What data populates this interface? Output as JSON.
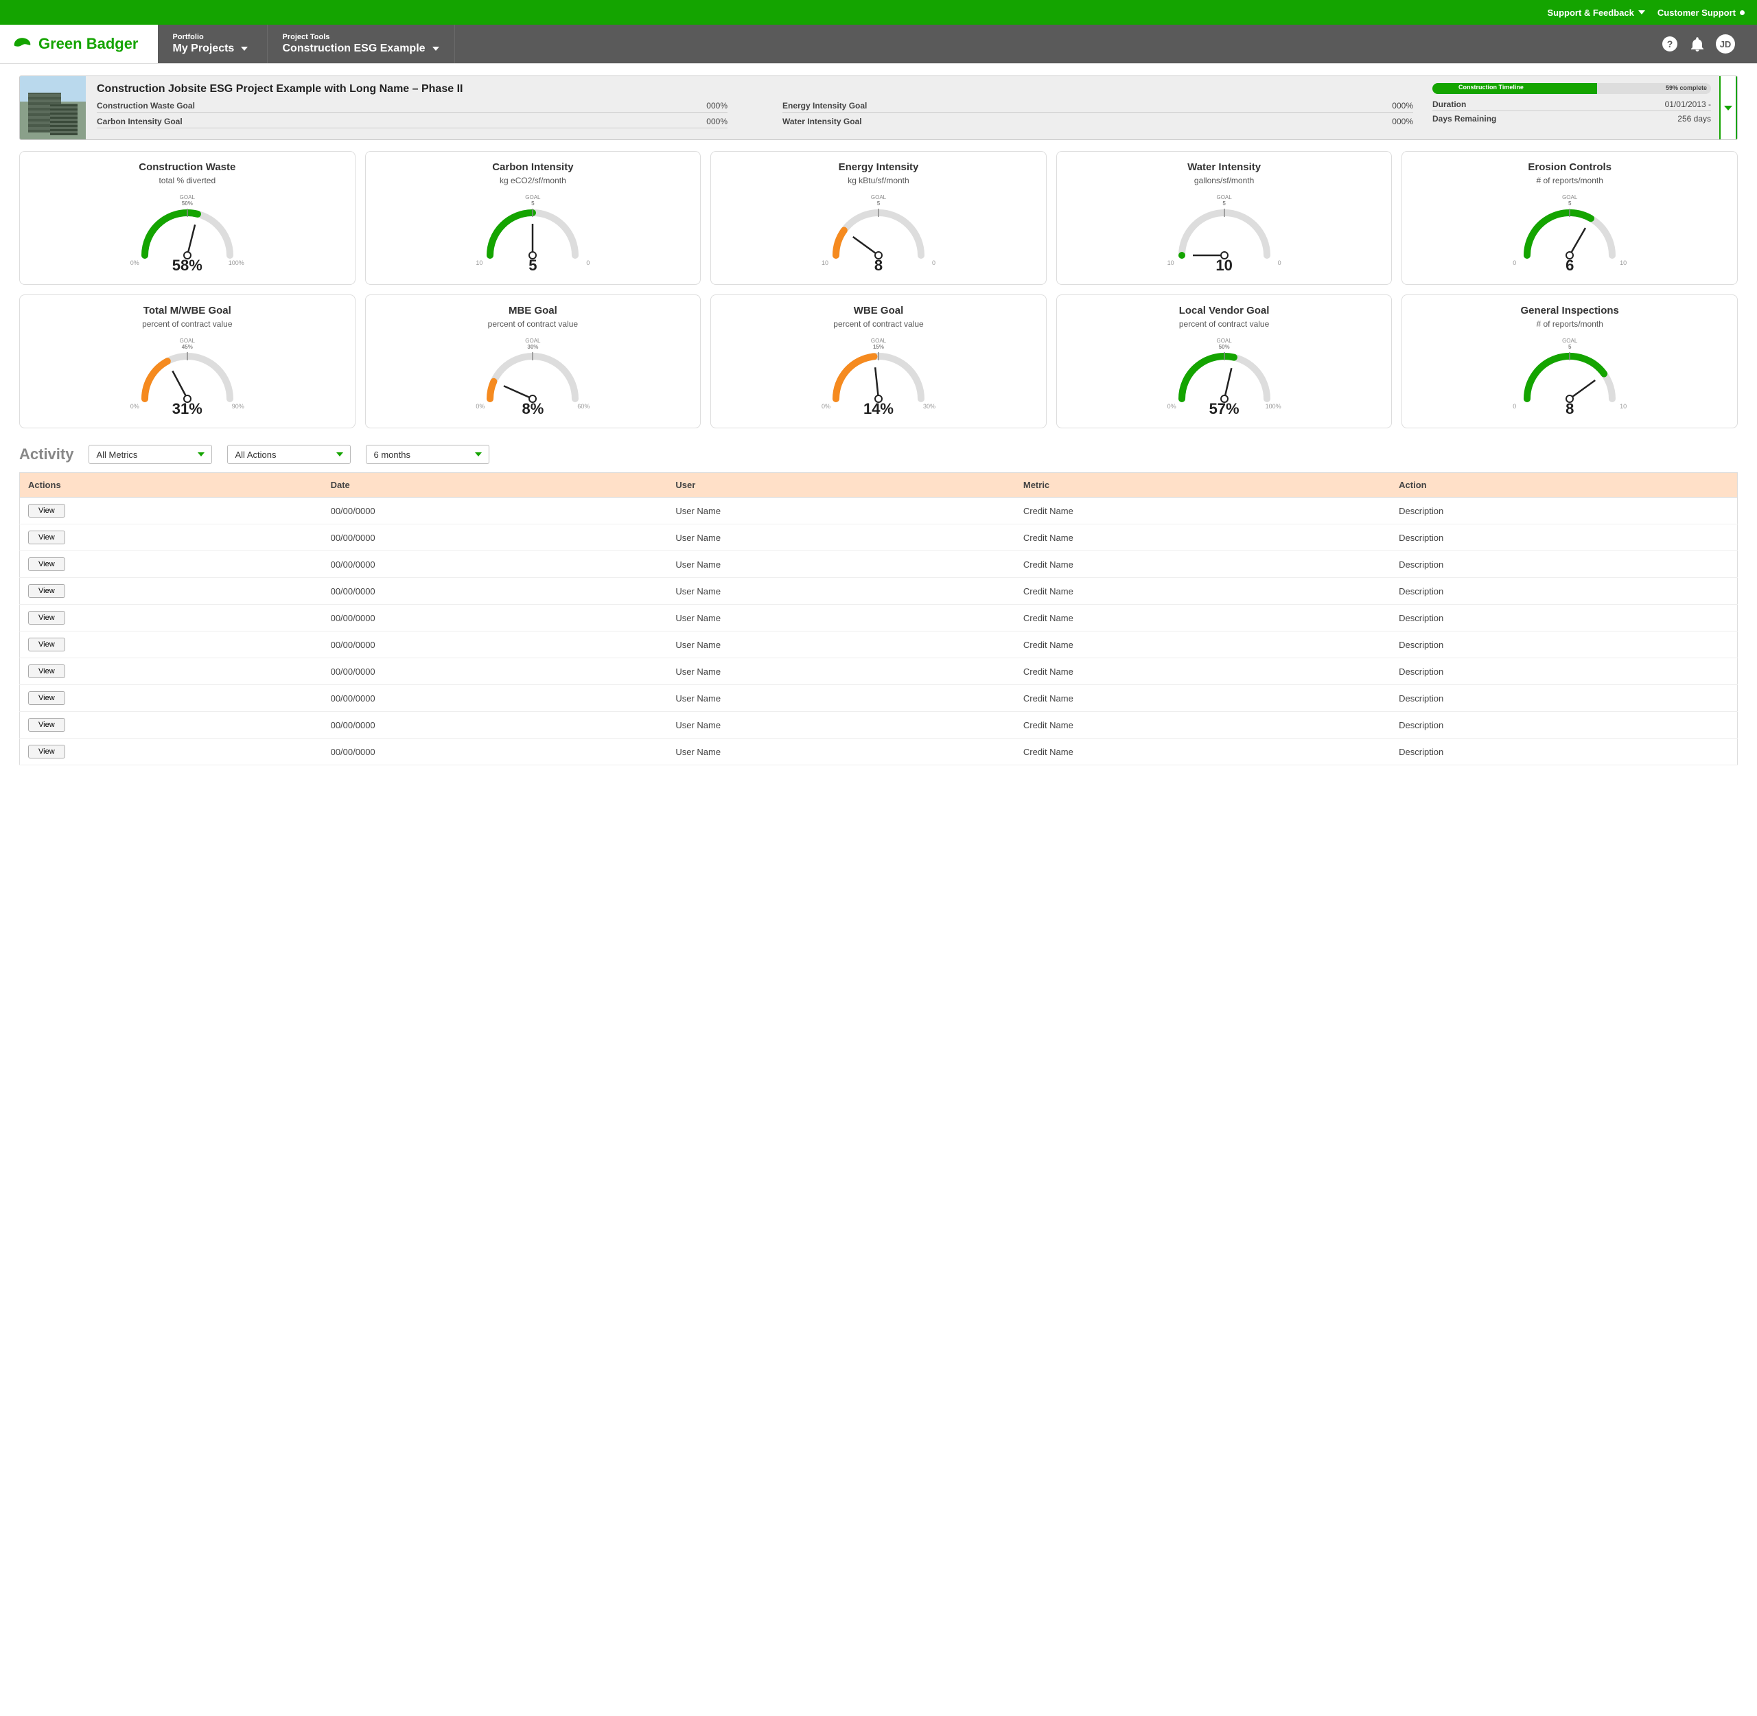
{
  "colors": {
    "brand": "#14a400",
    "accent_orange": "#f58a1f"
  },
  "topbar": {
    "support_feedback": "Support & Feedback",
    "customer_support": "Customer Support"
  },
  "brand": "Green Badger",
  "nav": {
    "portfolio_small": "Portfolio",
    "portfolio_big": "My Projects",
    "tools_small": "Project Tools",
    "tools_big": "Construction ESG Example"
  },
  "user": {
    "initials": "JD"
  },
  "project": {
    "title": "Construction Jobsite ESG Project Example with Long Name – Phase II",
    "timeline_label": "Construction Timeline",
    "timeline_pct": "59% complete",
    "goals": [
      {
        "label": "Construction Waste Goal",
        "value": "000%"
      },
      {
        "label": "Energy Intensity Goal",
        "value": "000%"
      },
      {
        "label": "Duration",
        "value": "01/01/2013 -"
      },
      {
        "label": "Carbon Intensity Goal",
        "value": "000%"
      },
      {
        "label": "Water Intensity Goal",
        "value": "000%"
      },
      {
        "label": "Days Remaining",
        "value": "256 days"
      }
    ]
  },
  "gauges": [
    {
      "title": "Construction Waste",
      "sub": "total % diverted",
      "goal": "50%",
      "left": "0%",
      "right": "100%",
      "value": "58%",
      "fill_deg": 104,
      "color": "#14a400"
    },
    {
      "title": "Carbon Intensity",
      "sub": "kg eCO2/sf/month",
      "goal": "5",
      "left": "10",
      "right": "0",
      "value": "5",
      "fill_deg": 90,
      "color": "#14a400"
    },
    {
      "title": "Energy Intensity",
      "sub": "kg kBtu/sf/month",
      "goal": "5",
      "left": "10",
      "right": "0",
      "value": "8",
      "fill_deg": 36,
      "color": "#f58a1f"
    },
    {
      "title": "Water Intensity",
      "sub": "gallons/sf/month",
      "goal": "5",
      "left": "10",
      "right": "0",
      "value": "10",
      "fill_deg": 0,
      "color": "#14a400"
    },
    {
      "title": "Erosion Controls",
      "sub": "# of reports/month",
      "goal": "5",
      "left": "0",
      "right": "10",
      "value": "6",
      "fill_deg": 120,
      "color": "#14a400"
    },
    {
      "title": "Total M/WBE Goal",
      "sub": "percent of contract value",
      "goal": "45%",
      "left": "0%",
      "right": "90%",
      "value": "31%",
      "fill_deg": 62,
      "color": "#f58a1f"
    },
    {
      "title": "MBE Goal",
      "sub": "percent of contract value",
      "goal": "30%",
      "left": "0%",
      "right": "60%",
      "value": "8%",
      "fill_deg": 24,
      "color": "#f58a1f"
    },
    {
      "title": "WBE Goal",
      "sub": "percent of contract value",
      "goal": "15%",
      "left": "0%",
      "right": "30%",
      "value": "14%",
      "fill_deg": 84,
      "color": "#f58a1f"
    },
    {
      "title": "Local Vendor Goal",
      "sub": "percent of contract value",
      "goal": "50%",
      "left": "0%",
      "right": "100%",
      "value": "57%",
      "fill_deg": 103,
      "color": "#14a400"
    },
    {
      "title": "General Inspections",
      "sub": "# of reports/month",
      "goal": "5",
      "left": "0",
      "right": "10",
      "value": "8",
      "fill_deg": 144,
      "color": "#14a400"
    }
  ],
  "activity": {
    "heading": "Activity",
    "filter_metrics": "All Metrics",
    "filter_actions": "All Actions",
    "filter_range": "6 months",
    "columns": [
      "Actions",
      "Date",
      "User",
      "Metric",
      "Action"
    ],
    "view_label": "View",
    "rows": [
      {
        "date": "00/00/0000",
        "user": "User Name",
        "metric": "Credit Name",
        "action": "Description"
      },
      {
        "date": "00/00/0000",
        "user": "User Name",
        "metric": "Credit Name",
        "action": "Description"
      },
      {
        "date": "00/00/0000",
        "user": "User Name",
        "metric": "Credit Name",
        "action": "Description"
      },
      {
        "date": "00/00/0000",
        "user": "User Name",
        "metric": "Credit Name",
        "action": "Description"
      },
      {
        "date": "00/00/0000",
        "user": "User Name",
        "metric": "Credit Name",
        "action": "Description"
      },
      {
        "date": "00/00/0000",
        "user": "User Name",
        "metric": "Credit Name",
        "action": "Description"
      },
      {
        "date": "00/00/0000",
        "user": "User Name",
        "metric": "Credit Name",
        "action": "Description"
      },
      {
        "date": "00/00/0000",
        "user": "User Name",
        "metric": "Credit Name",
        "action": "Description"
      },
      {
        "date": "00/00/0000",
        "user": "User Name",
        "metric": "Credit Name",
        "action": "Description"
      },
      {
        "date": "00/00/0000",
        "user": "User Name",
        "metric": "Credit Name",
        "action": "Description"
      }
    ]
  },
  "chart_data": {
    "type": "gauge-grid",
    "gauges": [
      {
        "name": "Construction Waste",
        "unit": "total % diverted",
        "range": [
          0,
          100
        ],
        "goal": 50,
        "value": 58
      },
      {
        "name": "Carbon Intensity",
        "unit": "kg eCO2/sf/month",
        "range": [
          10,
          0
        ],
        "goal": 5,
        "value": 5
      },
      {
        "name": "Energy Intensity",
        "unit": "kg kBtu/sf/month",
        "range": [
          10,
          0
        ],
        "goal": 5,
        "value": 8
      },
      {
        "name": "Water Intensity",
        "unit": "gallons/sf/month",
        "range": [
          10,
          0
        ],
        "goal": 5,
        "value": 10
      },
      {
        "name": "Erosion Controls",
        "unit": "# of reports/month",
        "range": [
          0,
          10
        ],
        "goal": 5,
        "value": 6
      },
      {
        "name": "Total M/WBE Goal",
        "unit": "percent of contract value",
        "range": [
          0,
          90
        ],
        "goal": 45,
        "value": 31
      },
      {
        "name": "MBE Goal",
        "unit": "percent of contract value",
        "range": [
          0,
          60
        ],
        "goal": 30,
        "value": 8
      },
      {
        "name": "WBE Goal",
        "unit": "percent of contract value",
        "range": [
          0,
          30
        ],
        "goal": 15,
        "value": 14
      },
      {
        "name": "Local Vendor Goal",
        "unit": "percent of contract value",
        "range": [
          0,
          100
        ],
        "goal": 50,
        "value": 57
      },
      {
        "name": "General Inspections",
        "unit": "# of reports/month",
        "range": [
          0,
          10
        ],
        "goal": 5,
        "value": 8
      }
    ]
  }
}
